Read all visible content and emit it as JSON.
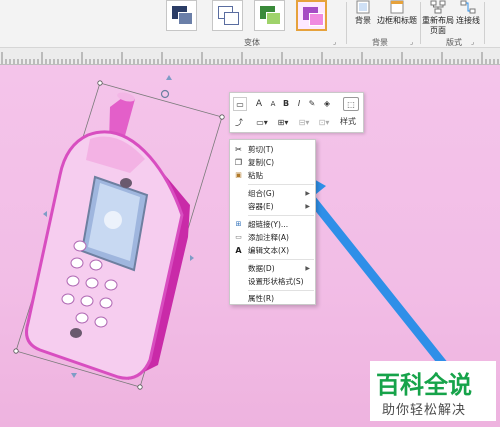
{
  "ribbon": {
    "theme_tiles": [
      {
        "name": "variant-1",
        "color_a": "#2b3d66",
        "color_b": "#6b7fa8"
      },
      {
        "name": "variant-2",
        "color_a": "#5a6da0",
        "color_b": "#8ea2cf"
      },
      {
        "name": "variant-3",
        "color_a": "#3a8a3a",
        "color_b": "#9fd36b"
      },
      {
        "name": "variant-4",
        "color_a": "#a64bc4",
        "color_b": "#f08ae0"
      }
    ],
    "variants_group_label": "变体",
    "background_btn": "背景",
    "borders_titles_btn": "边框和标题",
    "background_group_label": "背景",
    "relayout_btn_line1": "重新布局",
    "relayout_btn_line2": "页面",
    "connectors_btn": "连接线",
    "layout_group_label": "版式"
  },
  "mini_toolbar": {
    "row1": [
      "A",
      "A",
      "B",
      "I"
    ],
    "style_label": "样式"
  },
  "context_menu": {
    "items": [
      {
        "label": "剪切(T)",
        "icon": "scissors-icon",
        "glyph": "✂"
      },
      {
        "label": "复制(C)",
        "icon": "copy-icon",
        "glyph": "❐"
      },
      {
        "label": "粘贴",
        "icon": "paste-icon",
        "glyph": "📋"
      },
      {
        "label": "组合(G)",
        "icon": "",
        "glyph": "",
        "submenu": true
      },
      {
        "label": "容器(E)",
        "icon": "",
        "glyph": "",
        "submenu": true
      },
      {
        "label": "超链接(Y)...",
        "icon": "hyperlink-icon",
        "glyph": "🔗"
      },
      {
        "label": "添加注释(A)",
        "icon": "comment-icon",
        "glyph": "🗨"
      },
      {
        "label": "编辑文本(X)",
        "icon": "edit-text-icon",
        "glyph": "A"
      },
      {
        "label": "数据(D)",
        "icon": "",
        "glyph": "",
        "submenu": true
      },
      {
        "label": "设置形状格式(S)",
        "icon": "",
        "glyph": ""
      },
      {
        "label": "属性(R)",
        "icon": "",
        "glyph": ""
      }
    ]
  },
  "watermark": {
    "title": "百科全说",
    "subtitle": "助你轻松解决"
  },
  "colors": {
    "canvas_bg": "#f4c4ea",
    "phone_body": "#e66bd0",
    "phone_dark": "#c92aa8",
    "phone_face": "#f7d2ef",
    "arrow_blue": "#2f8fe8",
    "watermark_green": "#16a34a"
  }
}
